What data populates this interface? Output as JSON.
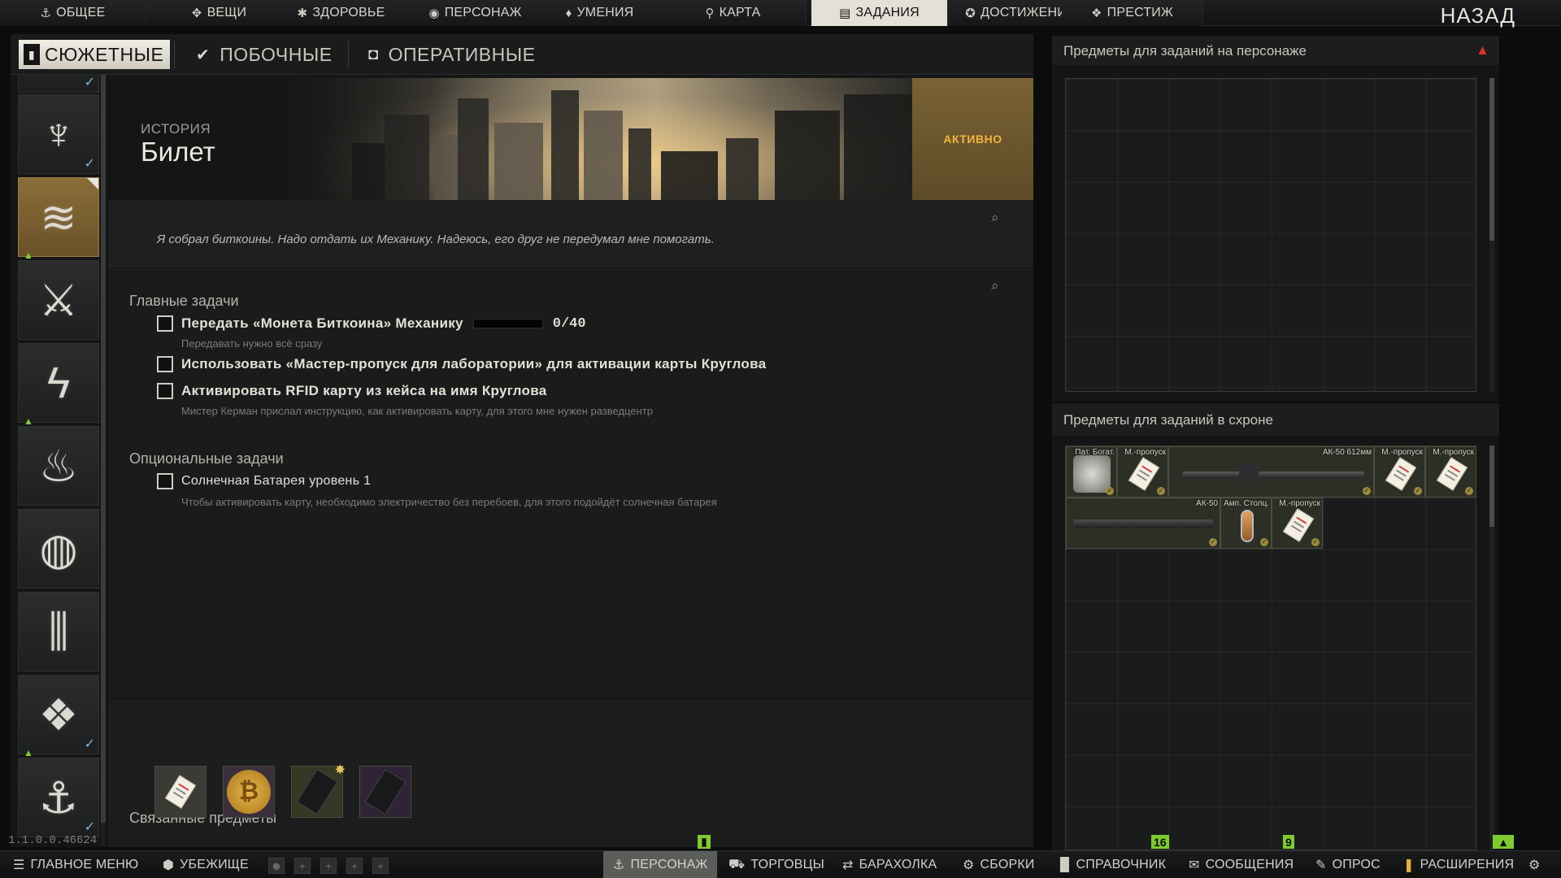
{
  "top_nav": {
    "items": [
      {
        "label": "ОБЩЕЕ",
        "icon": "person-icon",
        "active": false
      },
      {
        "label": "ВЕЩИ",
        "icon": "gear-items-icon",
        "active": false
      },
      {
        "label": "ЗДОРОВЬЕ",
        "icon": "health-icon",
        "active": false
      },
      {
        "label": "ПЕРСОНАЖ",
        "icon": "character-icon",
        "active": false
      },
      {
        "label": "УМЕНИЯ",
        "icon": "skills-icon",
        "active": false
      },
      {
        "label": "КАРТА",
        "icon": "map-pin-icon",
        "active": false
      },
      {
        "label": "ЗАДАНИЯ",
        "icon": "tasks-icon",
        "active": true
      },
      {
        "label": "ДОСТИЖЕНИЯ",
        "icon": "achievement-icon",
        "active": false
      },
      {
        "label": "ПРЕСТИЖ",
        "icon": "prestige-icon",
        "active": false
      }
    ],
    "back_label": "НАЗАД"
  },
  "quest_tabs": [
    {
      "label": "СЮЖЕТНЫЕ",
      "icon": "story-icon",
      "active": true
    },
    {
      "label": "ПОБОЧНЫЕ",
      "icon": "check-circle-icon",
      "active": false
    },
    {
      "label": "ОПЕРАТИВНЫЕ",
      "icon": "operational-icon",
      "active": false
    }
  ],
  "quest": {
    "kicker": "ИСТОРИЯ",
    "title": "Билет",
    "status": "АКТИВНО",
    "description": "Я собрал биткоины. Надо отдать их Механику. Надеюсь, его друг не передумал мне помогать.",
    "main_tasks_header": "Главные задачи",
    "main_tasks": [
      {
        "text": "Передать «Монета Биткоина» Механику",
        "progress_text": "0/40",
        "progress": 0,
        "note": "Передавать нужно всё сразу"
      },
      {
        "text": "Использовать «Мастер-пропуск для лаборатории» для активации карты Круглова",
        "note": ""
      },
      {
        "text": "Активировать RFID карту из кейса на имя Круглова",
        "note": "Мистер Керман прислал инструкцию, как активировать карту, для этого мне нужен разведцентр"
      }
    ],
    "optional_tasks_header": "Опциональные задачи",
    "optional_tasks": [
      {
        "text": "Солнечная Батарея уровень 1",
        "note": "Чтобы активировать карту, необходимо электричество без перебоев, для этого подойдёт солнечная батарея"
      }
    ],
    "related_header": "Связанные предметы",
    "related_items": [
      "keycard-pass-icon",
      "bitcoin-icon",
      "rfid-card-yellow-icon",
      "rfid-card-dark-icon"
    ]
  },
  "right": {
    "character_panel_title": "Предметы для заданий на персонаже",
    "stash_panel_title": "Предметы для заданий в схроне",
    "stash_items": [
      {
        "label": "Пат. Богат.",
        "icon": "patch-icon"
      },
      {
        "label": "М.-пропуск",
        "icon": "keycard-pass-icon"
      },
      {
        "label": "АК-50 612мм",
        "icon": "barrel-icon"
      },
      {
        "label": "М.-пропуск",
        "icon": "keycard-pass-icon"
      },
      {
        "label": "М.-пропуск",
        "icon": "keycard-pass-icon"
      },
      {
        "label": "АК-50",
        "icon": "barrel-icon"
      },
      {
        "label": "Амп. Столц.",
        "icon": "ampoule-icon"
      },
      {
        "label": "М.-пропуск",
        "icon": "keycard-pass-icon"
      }
    ]
  },
  "build_version": "1.1.0.0.46624",
  "bottom_bar": {
    "items": [
      {
        "label": "ГЛАВНОЕ МЕНЮ",
        "icon": "menu-icon"
      },
      {
        "label": "УБЕЖИЩЕ",
        "icon": "hideout-icon"
      },
      {
        "label": "ПЕРСОНАЖ",
        "icon": "character-icon",
        "active": true
      },
      {
        "label": "ТОРГОВЦЫ",
        "icon": "cart-icon"
      },
      {
        "label": "БАРАХОЛКА",
        "icon": "flea-market-icon"
      },
      {
        "label": "СБОРКИ",
        "icon": "builds-icon"
      },
      {
        "label": "СПРАВОЧНИК",
        "icon": "handbook-icon"
      },
      {
        "label": "СООБЩЕНИЯ",
        "icon": "messages-icon"
      },
      {
        "label": "ОПРОС",
        "icon": "survey-icon"
      },
      {
        "label": "РАСШИРЕНИЯ",
        "icon": "extensions-icon"
      }
    ],
    "badges": {
      "traders": "16",
      "handbook": "9"
    }
  },
  "colors": {
    "accent_gold": "#f0b53a",
    "badge_green": "#7ecb2f",
    "active_tab": "#e3e0d7"
  }
}
